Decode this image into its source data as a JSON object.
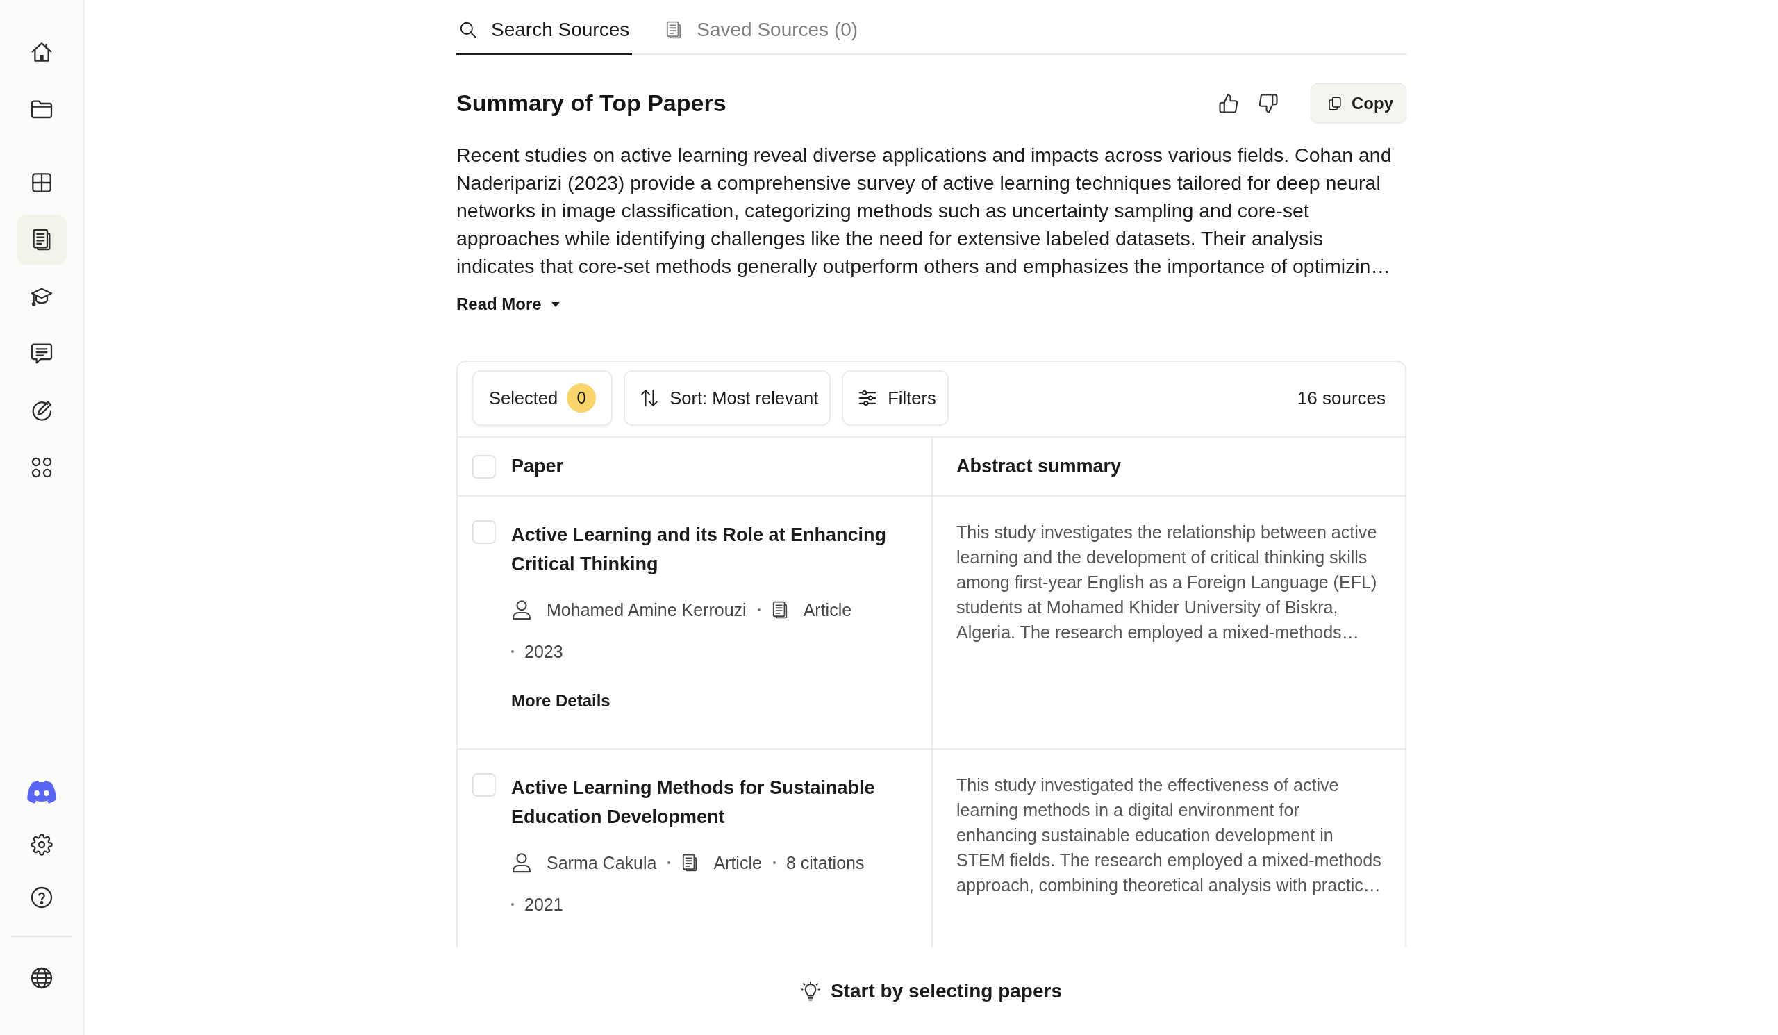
{
  "sidebar": {
    "main_groups": [
      {
        "items": [
          {
            "kind": "home",
            "selected": false
          },
          {
            "kind": "folder",
            "selected": false
          }
        ]
      },
      {
        "items": [
          {
            "kind": "grid",
            "selected": false
          },
          {
            "kind": "papers",
            "selected": true
          },
          {
            "kind": "cap",
            "selected": false
          },
          {
            "kind": "chat",
            "selected": false
          },
          {
            "kind": "pen",
            "selected": false
          },
          {
            "kind": "apps",
            "selected": false
          }
        ]
      }
    ],
    "bottom_groups": [
      {
        "items": [
          {
            "kind": "community",
            "selected": false
          },
          {
            "kind": "settings",
            "selected": false
          },
          {
            "kind": "help",
            "selected": false
          }
        ]
      },
      {
        "items": [
          {
            "kind": "language",
            "selected": false
          }
        ]
      }
    ]
  },
  "tabs": [
    {
      "kind": "search",
      "label": "Search Sources",
      "selected": true
    },
    {
      "kind": "saved",
      "label": "Saved Sources (0)",
      "selected": false
    }
  ],
  "summary": {
    "title": "Summary of Top Papers",
    "copy_label": "Copy",
    "text": "Recent studies on active learning reveal diverse applications and impacts across various fields. Cohan and Naderiparizi (2023) provide a comprehensive survey of active learning techniques tailored for deep neural networks in image classification, categorizing methods such as uncertainty sampling and core-set approaches while identifying challenges like the need for extensive labeled datasets. Their analysis indicates that core-set methods generally outperform others and emphasizes the importance of optimizin…",
    "read_more": "Read More"
  },
  "toolbar": {
    "selected_label": "Selected",
    "selected_count": "0",
    "sort_label": "Sort: Most relevant",
    "filters_label": "Filters",
    "source_count": "16 sources"
  },
  "table": {
    "select_all_checked": false,
    "columns": [
      "Paper",
      "Abstract summary"
    ],
    "rows": [
      {
        "checked": false,
        "title": "Active Learning and its Role at Enhancing Critical Thinking",
        "author": "Mohamed Amine Kerrouzi",
        "type": "Article",
        "year": "2023",
        "link": "More Details",
        "abstract": "This study investigates the relationship between active learning and the development of critical thinking skills among first-year English as a Foreign Language (EFL) students at Mohamed Khider University of Biskra, Algeria. The research employed a mixed-methods…"
      },
      {
        "checked": false,
        "title": "Active Learning Methods for Sustainable Education Development",
        "author": "Sarma Cakula",
        "type": "Article",
        "citations": "8 citations",
        "year": "2021",
        "abstract": "This study investigated the effectiveness of active learning methods in a digital environment for enhancing sustainable education development in STEM fields. The research employed a mixed-methods approach, combining theoretical analysis with practic…"
      }
    ]
  },
  "footer": {
    "hint": "Start by selecting papers"
  }
}
